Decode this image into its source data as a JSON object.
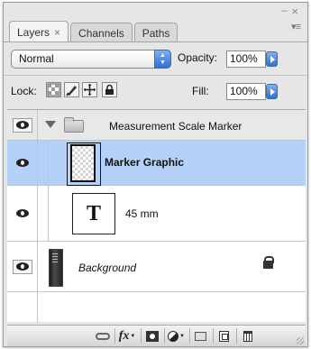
{
  "panel": {
    "window_controls": {
      "collapse_glyph": "–",
      "close_glyph": "×",
      "menu_glyph": "▾≡"
    },
    "tabs": [
      {
        "label": "Layers",
        "close": "×",
        "active": true
      },
      {
        "label": "Channels",
        "active": false
      },
      {
        "label": "Paths",
        "active": false
      }
    ],
    "blend_mode": {
      "value": "Normal"
    },
    "opacity": {
      "label": "Opacity:",
      "value": "100%"
    },
    "lock": {
      "label": "Lock:",
      "icons": [
        "lock-transparent-pixels-icon",
        "lock-image-pixels-icon",
        "lock-position-icon",
        "lock-all-icon"
      ]
    },
    "fill": {
      "label": "Fill:",
      "value": "100%"
    },
    "layers": [
      {
        "type": "group",
        "name": "Measurement Scale Marker",
        "expanded": true,
        "visible": true
      },
      {
        "type": "layer",
        "name": "Marker Graphic",
        "selected": true,
        "visible": true
      },
      {
        "type": "text",
        "name": "45 mm",
        "thumb_glyph": "T",
        "visible": true
      },
      {
        "type": "background",
        "name": "Background",
        "locked": true,
        "visible": true
      }
    ],
    "toolbar": {
      "fx_label": "fx",
      "icons": [
        "link-layers-icon",
        "layer-style-icon",
        "layer-mask-icon",
        "adjustment-layer-icon",
        "new-group-icon",
        "new-layer-icon",
        "delete-layer-icon"
      ]
    },
    "colors": {
      "selection": "#b4d1f8",
      "panel_bg": "#e6e6e6",
      "aqua_accent": "#2f6fd8"
    }
  }
}
